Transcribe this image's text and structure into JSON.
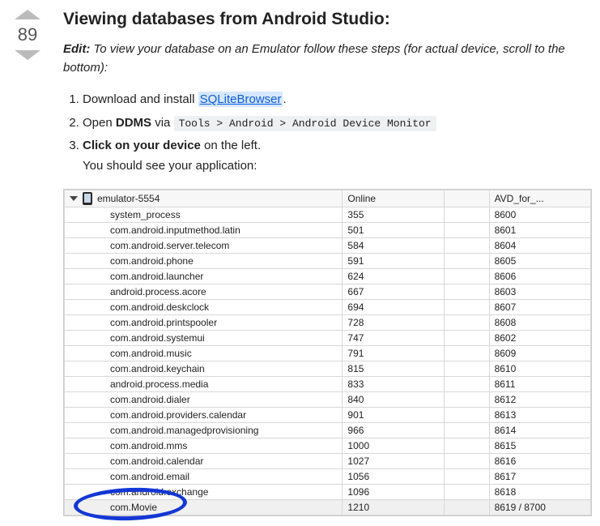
{
  "vote": {
    "count": "89"
  },
  "title": "Viewing databases from Android Studio:",
  "edit": {
    "label": "Edit:",
    "text": "To view your database on an Emulator follow these steps (for actual device, scroll to the bottom):"
  },
  "steps": {
    "s1_pre": "Download and install ",
    "s1_link": "SQLiteBrowser",
    "s1_post": ".",
    "s2_pre": "Open ",
    "s2_bold": "DDMS",
    "s2_mid": " via ",
    "s2_code": "Tools > Android > Android Device Monitor",
    "s3_bold": "Click on your device",
    "s3_rest": " on the left.",
    "s3_sub": "You should see your application:"
  },
  "table": {
    "headers": {
      "name": "",
      "status": "Online",
      "empty": "",
      "avd": "AVD_for_..."
    },
    "root": "emulator-5554",
    "root_status": "",
    "rows": [
      {
        "name": "system_process",
        "pid": "355",
        "port": "8600"
      },
      {
        "name": "com.android.inputmethod.latin",
        "pid": "501",
        "port": "8601"
      },
      {
        "name": "com.android.server.telecom",
        "pid": "584",
        "port": "8604"
      },
      {
        "name": "com.android.phone",
        "pid": "591",
        "port": "8605"
      },
      {
        "name": "com.android.launcher",
        "pid": "624",
        "port": "8606"
      },
      {
        "name": "android.process.acore",
        "pid": "667",
        "port": "8603"
      },
      {
        "name": "com.android.deskclock",
        "pid": "694",
        "port": "8607"
      },
      {
        "name": "com.android.printspooler",
        "pid": "728",
        "port": "8608"
      },
      {
        "name": "com.android.systemui",
        "pid": "747",
        "port": "8602"
      },
      {
        "name": "com.android.music",
        "pid": "791",
        "port": "8609"
      },
      {
        "name": "com.android.keychain",
        "pid": "815",
        "port": "8610"
      },
      {
        "name": "android.process.media",
        "pid": "833",
        "port": "8611"
      },
      {
        "name": "com.android.dialer",
        "pid": "840",
        "port": "8612"
      },
      {
        "name": "com.android.providers.calendar",
        "pid": "901",
        "port": "8613"
      },
      {
        "name": "com.android.managedprovisioning",
        "pid": "966",
        "port": "8614"
      },
      {
        "name": "com.android.mms",
        "pid": "1000",
        "port": "8615"
      },
      {
        "name": "com.android.calendar",
        "pid": "1027",
        "port": "8616"
      },
      {
        "name": "com.android.email",
        "pid": "1056",
        "port": "8617"
      },
      {
        "name": "com.android.exchange",
        "pid": "1096",
        "port": "8618"
      },
      {
        "name": "com.Movie",
        "pid": "1210",
        "port": "8619 / 8700",
        "hl": true
      }
    ]
  }
}
